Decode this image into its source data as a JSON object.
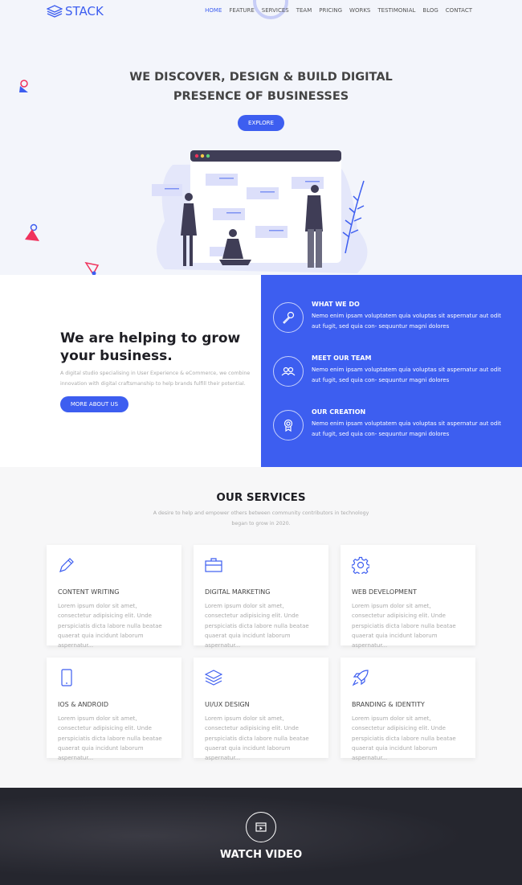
{
  "header": {
    "logo": "STACK",
    "nav": [
      "HOME",
      "FEATURE",
      "SERVICES",
      "TEAM",
      "PRICING",
      "WORKS",
      "TESTIMONIAL",
      "BLOG",
      "CONTACT"
    ],
    "active": "HOME"
  },
  "hero": {
    "title_line1": "WE DISCOVER, DESIGN & BUILD DIGITAL",
    "title_line2": "PRESENCE OF BUSINESSES",
    "button": "EXPLORE"
  },
  "about": {
    "title_line1": "We are helping to grow",
    "title_line2": "your business.",
    "text_line1": "A digital studio specialising in User Experience & eCommerce, we combine",
    "text_line2": "innovation with digital craftsmanship to help brands fulfill their potential.",
    "button": "MORE ABOUT US"
  },
  "features": [
    {
      "icon": "microphone-icon",
      "title": "WHAT WE DO",
      "text": "Nemo enim ipsam voluptatem quia voluptas sit aspernatur aut odit aut fugit, sed quia con- sequuntur magni dolores"
    },
    {
      "icon": "team-icon",
      "title": "MEET OUR TEAM",
      "text": "Nemo enim ipsam voluptatem quia voluptas sit aspernatur aut odit aut fugit, sed quia con- sequuntur magni dolores"
    },
    {
      "icon": "award-icon",
      "title": "OUR CREATION",
      "text": "Nemo enim ipsam voluptatem quia voluptas sit aspernatur aut odit aut fugit, sed quia con- sequuntur magni dolores"
    }
  ],
  "services": {
    "title": "OUR SERVICES",
    "subtitle_line1": "A desire to help and empower others between community contributors in technology",
    "subtitle_line2": "began to grow in 2020.",
    "cards": [
      {
        "icon": "pencil-icon",
        "title": "CONTENT WRITING",
        "text": "Lorem ipsum dolor sit amet, consectetur adipisicing elit. Unde perspiciatis dicta labore nulla beatae quaerat quia incidunt laborum aspernatur..."
      },
      {
        "icon": "briefcase-icon",
        "title": "DIGITAL MARKETING",
        "text": "Lorem ipsum dolor sit amet, consectetur adipisicing elit. Unde perspiciatis dicta labore nulla beatae quaerat quia incidunt laborum aspernatur..."
      },
      {
        "icon": "gear-icon",
        "title": "WEB DEVELOPMENT",
        "text": "Lorem ipsum dolor sit amet, consectetur adipisicing elit. Unde perspiciatis dicta labore nulla beatae quaerat quia incidunt laborum aspernatur..."
      },
      {
        "icon": "smartphone-icon",
        "title": "IOS & ANDROID",
        "text": "Lorem ipsum dolor sit amet, consectetur adipisicing elit. Unde perspiciatis dicta labore nulla beatae quaerat quia incidunt laborum aspernatur..."
      },
      {
        "icon": "layers-icon",
        "title": "UI/UX DESIGN",
        "text": "Lorem ipsum dolor sit amet, consectetur adipisicing elit. Unde perspiciatis dicta labore nulla beatae quaerat quia incidunt laborum aspernatur..."
      },
      {
        "icon": "rocket-icon",
        "title": "BRANDING & IDENTITY",
        "text": "Lorem ipsum dolor sit amet, consectetur adipisicing elit. Unde perspiciatis dicta labore nulla beatae quaerat quia incidunt laborum aspernatur..."
      }
    ]
  },
  "video": {
    "title": "WATCH VIDEO",
    "icon": "video-play-icon"
  },
  "colors": {
    "accent": "#3d5ef0",
    "dark": "#25262e",
    "pink": "#f0325c"
  }
}
